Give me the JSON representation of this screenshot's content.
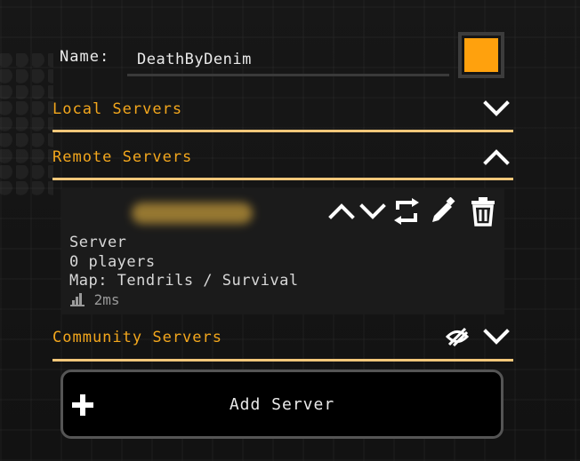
{
  "name_field": {
    "label": "Name:",
    "value": "DeathByDenim"
  },
  "player_color": "#ffa10d",
  "sections": {
    "local": {
      "title": "Local Servers",
      "expanded": false
    },
    "remote": {
      "title": "Remote Servers",
      "expanded": true
    },
    "community": {
      "title": "Community Servers",
      "expanded": false
    }
  },
  "server": {
    "name_obscured": true,
    "type": "Server",
    "players": "0 players",
    "map": "Map: Tendrils / Survival",
    "ping": "2ms"
  },
  "add_server_label": "Add Server",
  "icons": {
    "move_up": "chevron-up-icon",
    "move_down": "chevron-down-icon",
    "refresh": "refresh-icon",
    "edit": "pencil-icon",
    "delete": "trash-icon",
    "hide_community": "eye-off-icon",
    "add": "plus-icon"
  },
  "colors": {
    "accent": "#f3a71d",
    "divider": "#f3c77a"
  }
}
